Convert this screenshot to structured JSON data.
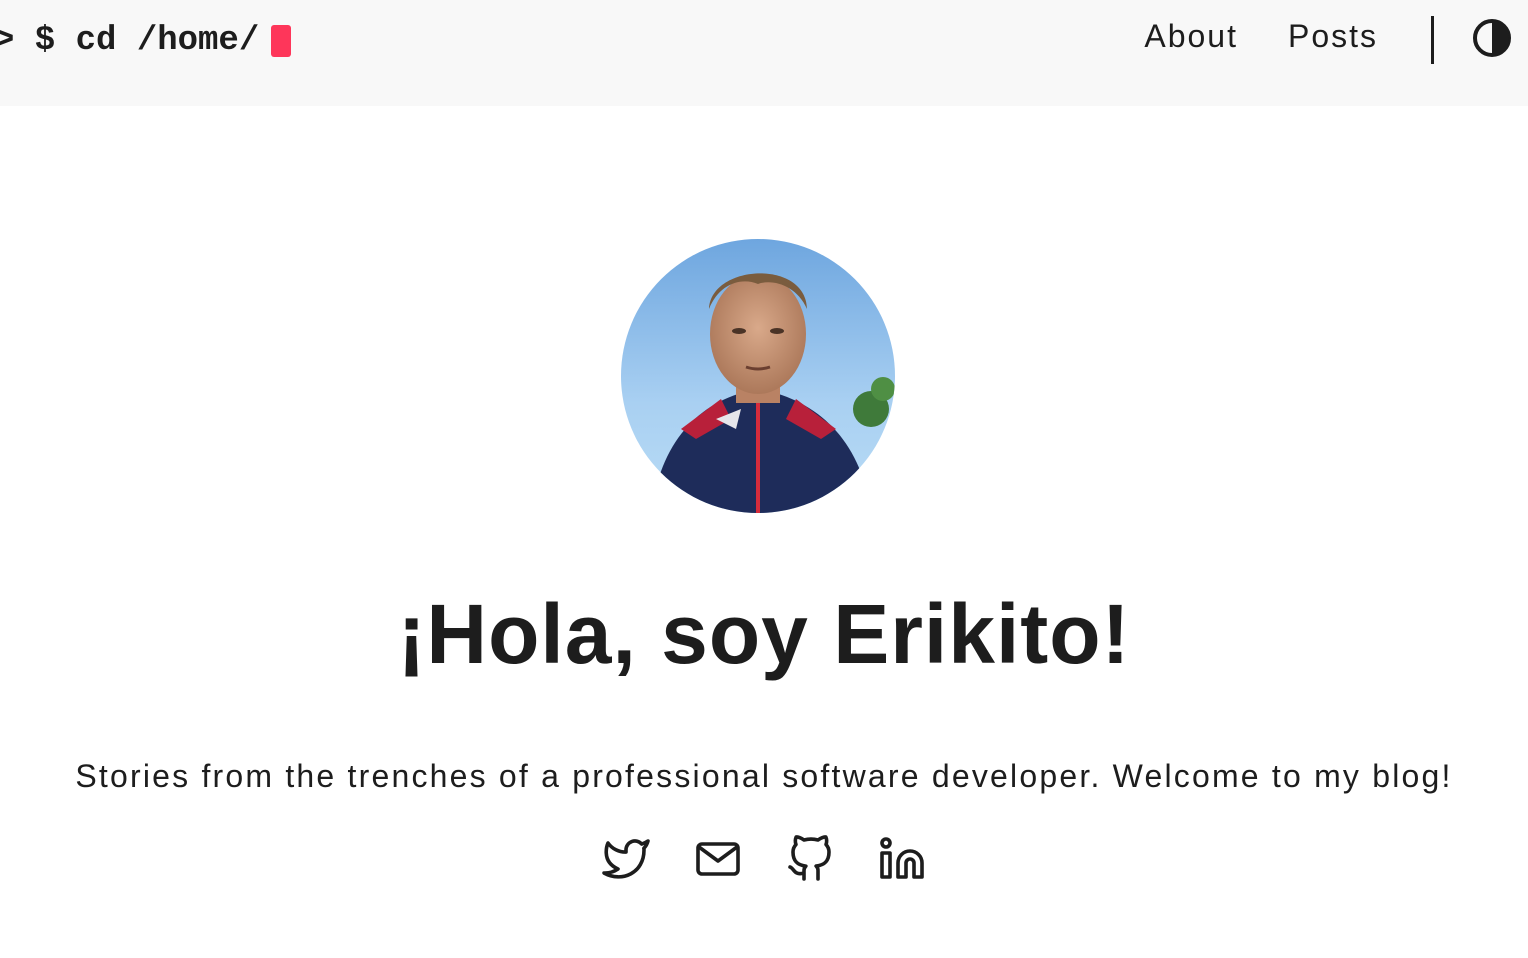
{
  "header": {
    "logo": {
      "prompt": "> $ cd /home/"
    },
    "nav": [
      {
        "label": "About"
      },
      {
        "label": "Posts"
      }
    ],
    "theme_toggle_icon": "contrast-half-circle-icon",
    "cursor_color": "#fe365a"
  },
  "profile": {
    "avatar": "profile-photo",
    "title": "¡Hola, soy Erikito!",
    "subtitle": "Stories from the trenches of a professional software developer. Welcome to my blog!",
    "socials": [
      {
        "icon": "twitter-icon"
      },
      {
        "icon": "email-icon"
      },
      {
        "icon": "github-icon"
      },
      {
        "icon": "linkedin-icon"
      }
    ]
  }
}
